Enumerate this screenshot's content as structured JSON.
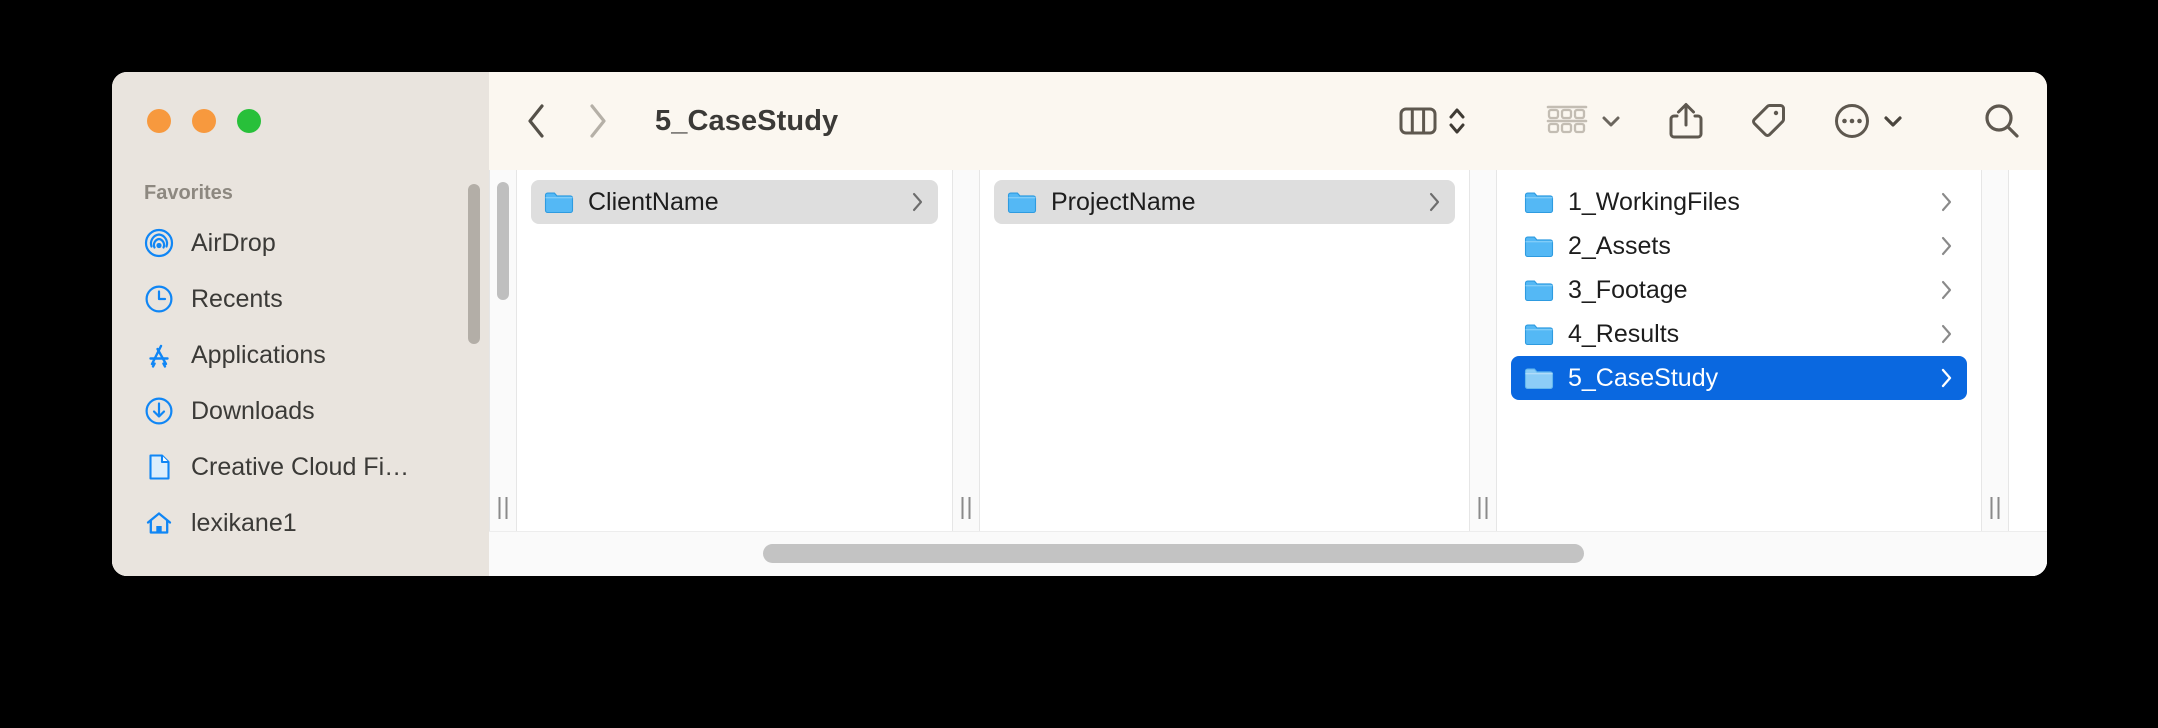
{
  "window": {
    "title": "5_CaseStudy",
    "traffic_lights": [
      {
        "name": "close",
        "color": "#F7993E"
      },
      {
        "name": "minimize",
        "color": "#F7993E"
      },
      {
        "name": "zoom",
        "color": "#28C03A"
      }
    ]
  },
  "toolbar": {
    "back_icon": "chevron-left-icon",
    "forward_icon": "chevron-right-icon",
    "view_mode_icon": "column-view-icon",
    "view_stepper_icon": "chevron-up-down-icon",
    "group_by_icon": "group-by-icon",
    "group_by_chevron_icon": "chevron-down-icon",
    "share_icon": "share-icon",
    "tag_icon": "tag-icon",
    "more_icon": "ellipsis-circle-icon",
    "more_chevron_icon": "chevron-down-icon",
    "search_icon": "search-icon"
  },
  "sidebar": {
    "section_title": "Favorites",
    "items": [
      {
        "label": "AirDrop",
        "icon": "airdrop-icon"
      },
      {
        "label": "Recents",
        "icon": "clock-icon"
      },
      {
        "label": "Applications",
        "icon": "applications-icon"
      },
      {
        "label": "Downloads",
        "icon": "download-circle-icon"
      },
      {
        "label": "Creative Cloud Fi…",
        "icon": "document-icon"
      },
      {
        "label": "lexikane1",
        "icon": "home-icon"
      }
    ]
  },
  "columns": [
    {
      "name": "column-1",
      "items": [
        {
          "label": "ClientName",
          "icon": "folder-icon",
          "state": "inactive-selected",
          "has_chevron": true
        }
      ]
    },
    {
      "name": "column-2",
      "items": [
        {
          "label": "ProjectName",
          "icon": "folder-icon",
          "state": "inactive-selected",
          "has_chevron": true
        }
      ]
    },
    {
      "name": "column-3",
      "items": [
        {
          "label": "1_WorkingFiles",
          "icon": "folder-icon",
          "state": "normal",
          "has_chevron": true
        },
        {
          "label": "2_Assets",
          "icon": "folder-icon",
          "state": "normal",
          "has_chevron": true
        },
        {
          "label": "3_Footage",
          "icon": "folder-icon",
          "state": "normal",
          "has_chevron": true
        },
        {
          "label": "4_Results",
          "icon": "folder-icon",
          "state": "normal",
          "has_chevron": true
        },
        {
          "label": "5_CaseStudy",
          "icon": "folder-icon",
          "state": "selected",
          "has_chevron": true
        }
      ]
    },
    {
      "name": "column-4",
      "items": []
    }
  ],
  "colors": {
    "selection_blue": "#0A68E0",
    "inactive_selection": "#DEDEDE",
    "sidebar_background": "#E9E4DE",
    "toolbar_background": "#FBF7F0",
    "folder_blue": "#54B8F5",
    "sidebar_icon_blue": "#1086F5",
    "page_background": "#000000"
  }
}
